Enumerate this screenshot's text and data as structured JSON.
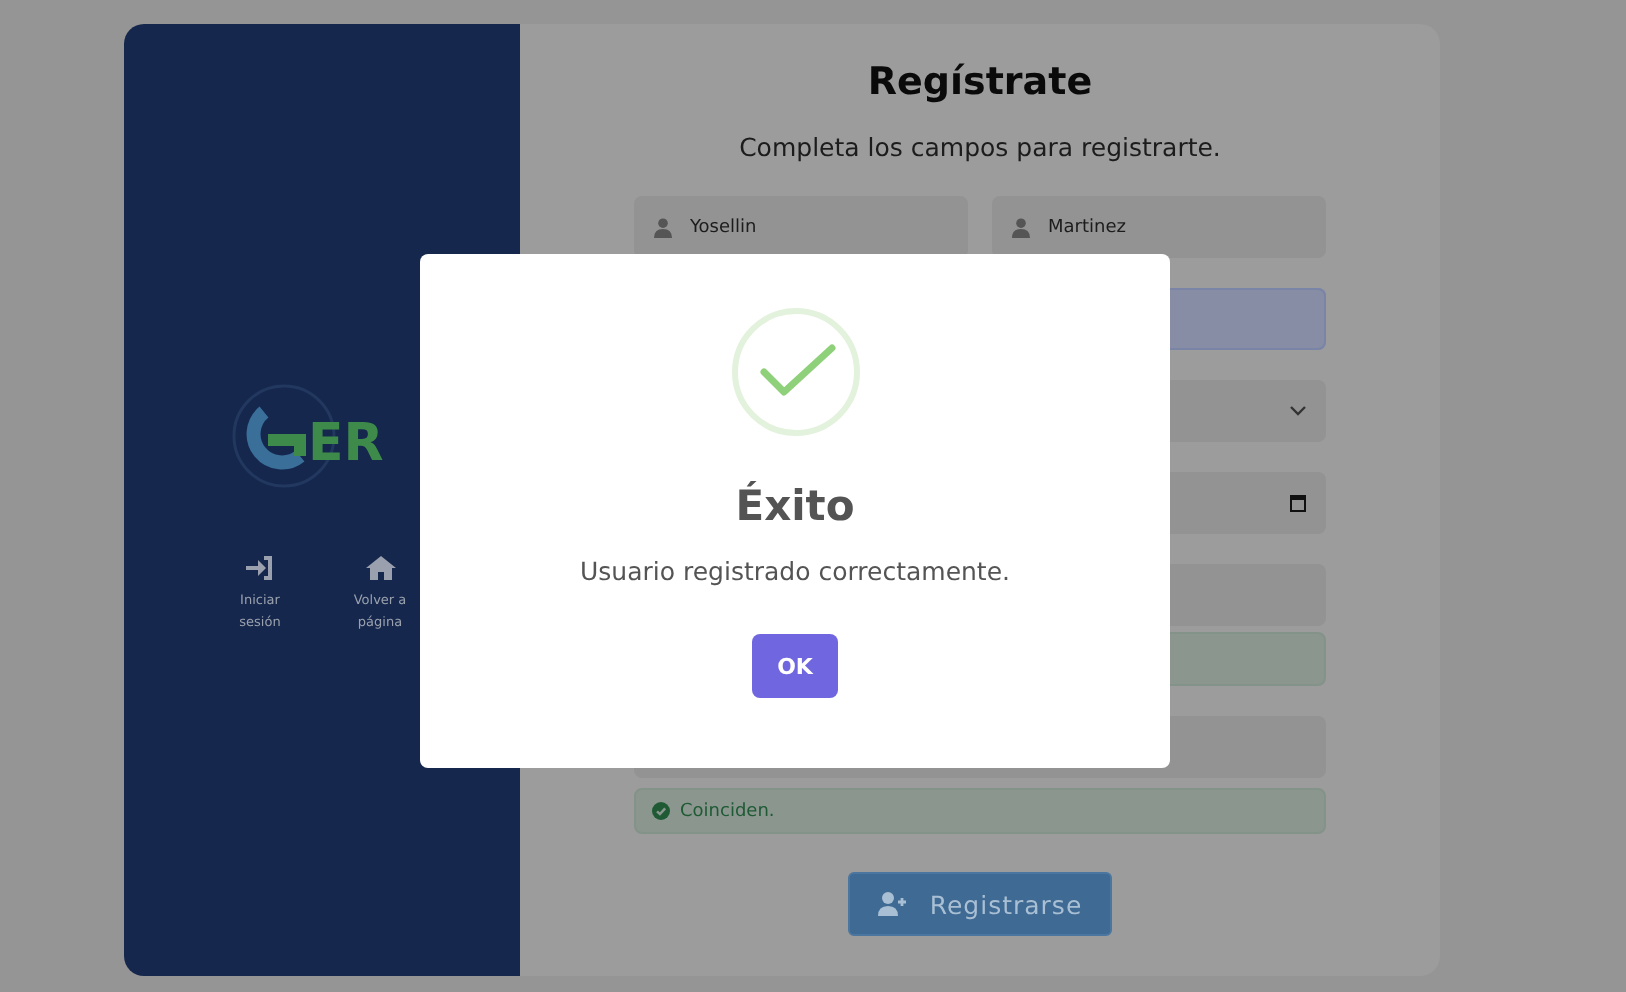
{
  "sidebar": {
    "logo_text": "ER",
    "nav": [
      {
        "kind": "login",
        "lines": [
          "Iniciar",
          "sesión"
        ]
      },
      {
        "kind": "home",
        "lines": [
          "Volver a",
          "página"
        ]
      }
    ]
  },
  "form": {
    "title": "Regístrate",
    "subtitle": "Completa los campos para registrarte.",
    "fields": [
      {
        "kind": "pair",
        "values": [
          "Yosellin",
          "Martinez"
        ]
      },
      {
        "kind": "input",
        "focused": true
      },
      {
        "kind": "select"
      },
      {
        "kind": "date"
      },
      {
        "kind": "input",
        "focused": false
      },
      {
        "kind": "alert"
      },
      {
        "kind": "input",
        "focused": false
      },
      {
        "kind": "alert",
        "message": "Coinciden."
      }
    ],
    "submit": "Registrarse"
  },
  "modal": {
    "title": "Éxito",
    "message": "Usuario registrado correctamente.",
    "button": "OK"
  }
}
